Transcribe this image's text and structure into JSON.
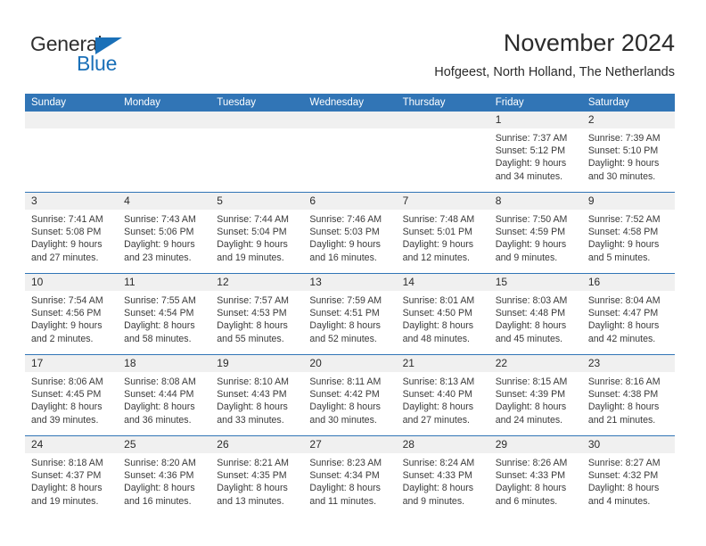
{
  "brand": {
    "name_part1": "General",
    "name_part2": "Blue",
    "triangle_color": "#1a70b8"
  },
  "header": {
    "title": "November 2024",
    "subtitle": "Hofgeest, North Holland, The Netherlands"
  },
  "theme": {
    "header_blue": "#3175b6",
    "date_band_gray": "#f0f0f0",
    "text_color": "#2b2b2b"
  },
  "calendar": {
    "day_headers": [
      "Sunday",
      "Monday",
      "Tuesday",
      "Wednesday",
      "Thursday",
      "Friday",
      "Saturday"
    ],
    "weeks": [
      {
        "days": [
          {
            "num": "",
            "lines": [
              "",
              "",
              "",
              ""
            ]
          },
          {
            "num": "",
            "lines": [
              "",
              "",
              "",
              ""
            ]
          },
          {
            "num": "",
            "lines": [
              "",
              "",
              "",
              ""
            ]
          },
          {
            "num": "",
            "lines": [
              "",
              "",
              "",
              ""
            ]
          },
          {
            "num": "",
            "lines": [
              "",
              "",
              "",
              ""
            ]
          },
          {
            "num": "1",
            "lines": [
              "Sunrise: 7:37 AM",
              "Sunset: 5:12 PM",
              "Daylight: 9 hours",
              "and 34 minutes."
            ]
          },
          {
            "num": "2",
            "lines": [
              "Sunrise: 7:39 AM",
              "Sunset: 5:10 PM",
              "Daylight: 9 hours",
              "and 30 minutes."
            ]
          }
        ]
      },
      {
        "days": [
          {
            "num": "3",
            "lines": [
              "Sunrise: 7:41 AM",
              "Sunset: 5:08 PM",
              "Daylight: 9 hours",
              "and 27 minutes."
            ]
          },
          {
            "num": "4",
            "lines": [
              "Sunrise: 7:43 AM",
              "Sunset: 5:06 PM",
              "Daylight: 9 hours",
              "and 23 minutes."
            ]
          },
          {
            "num": "5",
            "lines": [
              "Sunrise: 7:44 AM",
              "Sunset: 5:04 PM",
              "Daylight: 9 hours",
              "and 19 minutes."
            ]
          },
          {
            "num": "6",
            "lines": [
              "Sunrise: 7:46 AM",
              "Sunset: 5:03 PM",
              "Daylight: 9 hours",
              "and 16 minutes."
            ]
          },
          {
            "num": "7",
            "lines": [
              "Sunrise: 7:48 AM",
              "Sunset: 5:01 PM",
              "Daylight: 9 hours",
              "and 12 minutes."
            ]
          },
          {
            "num": "8",
            "lines": [
              "Sunrise: 7:50 AM",
              "Sunset: 4:59 PM",
              "Daylight: 9 hours",
              "and 9 minutes."
            ]
          },
          {
            "num": "9",
            "lines": [
              "Sunrise: 7:52 AM",
              "Sunset: 4:58 PM",
              "Daylight: 9 hours",
              "and 5 minutes."
            ]
          }
        ]
      },
      {
        "days": [
          {
            "num": "10",
            "lines": [
              "Sunrise: 7:54 AM",
              "Sunset: 4:56 PM",
              "Daylight: 9 hours",
              "and 2 minutes."
            ]
          },
          {
            "num": "11",
            "lines": [
              "Sunrise: 7:55 AM",
              "Sunset: 4:54 PM",
              "Daylight: 8 hours",
              "and 58 minutes."
            ]
          },
          {
            "num": "12",
            "lines": [
              "Sunrise: 7:57 AM",
              "Sunset: 4:53 PM",
              "Daylight: 8 hours",
              "and 55 minutes."
            ]
          },
          {
            "num": "13",
            "lines": [
              "Sunrise: 7:59 AM",
              "Sunset: 4:51 PM",
              "Daylight: 8 hours",
              "and 52 minutes."
            ]
          },
          {
            "num": "14",
            "lines": [
              "Sunrise: 8:01 AM",
              "Sunset: 4:50 PM",
              "Daylight: 8 hours",
              "and 48 minutes."
            ]
          },
          {
            "num": "15",
            "lines": [
              "Sunrise: 8:03 AM",
              "Sunset: 4:48 PM",
              "Daylight: 8 hours",
              "and 45 minutes."
            ]
          },
          {
            "num": "16",
            "lines": [
              "Sunrise: 8:04 AM",
              "Sunset: 4:47 PM",
              "Daylight: 8 hours",
              "and 42 minutes."
            ]
          }
        ]
      },
      {
        "days": [
          {
            "num": "17",
            "lines": [
              "Sunrise: 8:06 AM",
              "Sunset: 4:45 PM",
              "Daylight: 8 hours",
              "and 39 minutes."
            ]
          },
          {
            "num": "18",
            "lines": [
              "Sunrise: 8:08 AM",
              "Sunset: 4:44 PM",
              "Daylight: 8 hours",
              "and 36 minutes."
            ]
          },
          {
            "num": "19",
            "lines": [
              "Sunrise: 8:10 AM",
              "Sunset: 4:43 PM",
              "Daylight: 8 hours",
              "and 33 minutes."
            ]
          },
          {
            "num": "20",
            "lines": [
              "Sunrise: 8:11 AM",
              "Sunset: 4:42 PM",
              "Daylight: 8 hours",
              "and 30 minutes."
            ]
          },
          {
            "num": "21",
            "lines": [
              "Sunrise: 8:13 AM",
              "Sunset: 4:40 PM",
              "Daylight: 8 hours",
              "and 27 minutes."
            ]
          },
          {
            "num": "22",
            "lines": [
              "Sunrise: 8:15 AM",
              "Sunset: 4:39 PM",
              "Daylight: 8 hours",
              "and 24 minutes."
            ]
          },
          {
            "num": "23",
            "lines": [
              "Sunrise: 8:16 AM",
              "Sunset: 4:38 PM",
              "Daylight: 8 hours",
              "and 21 minutes."
            ]
          }
        ]
      },
      {
        "days": [
          {
            "num": "24",
            "lines": [
              "Sunrise: 8:18 AM",
              "Sunset: 4:37 PM",
              "Daylight: 8 hours",
              "and 19 minutes."
            ]
          },
          {
            "num": "25",
            "lines": [
              "Sunrise: 8:20 AM",
              "Sunset: 4:36 PM",
              "Daylight: 8 hours",
              "and 16 minutes."
            ]
          },
          {
            "num": "26",
            "lines": [
              "Sunrise: 8:21 AM",
              "Sunset: 4:35 PM",
              "Daylight: 8 hours",
              "and 13 minutes."
            ]
          },
          {
            "num": "27",
            "lines": [
              "Sunrise: 8:23 AM",
              "Sunset: 4:34 PM",
              "Daylight: 8 hours",
              "and 11 minutes."
            ]
          },
          {
            "num": "28",
            "lines": [
              "Sunrise: 8:24 AM",
              "Sunset: 4:33 PM",
              "Daylight: 8 hours",
              "and 9 minutes."
            ]
          },
          {
            "num": "29",
            "lines": [
              "Sunrise: 8:26 AM",
              "Sunset: 4:33 PM",
              "Daylight: 8 hours",
              "and 6 minutes."
            ]
          },
          {
            "num": "30",
            "lines": [
              "Sunrise: 8:27 AM",
              "Sunset: 4:32 PM",
              "Daylight: 8 hours",
              "and 4 minutes."
            ]
          }
        ]
      }
    ]
  }
}
